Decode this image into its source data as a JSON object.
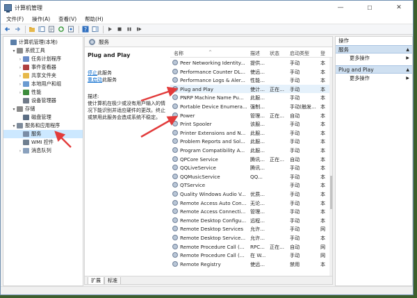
{
  "window": {
    "title": "计算机管理",
    "controls": {
      "minimize": "—",
      "maximize": "☐",
      "close": "✕"
    }
  },
  "menu": {
    "items": [
      "文件(F)",
      "操作(A)",
      "查看(V)",
      "帮助(H)"
    ]
  },
  "tree": {
    "items": [
      {
        "label": "计算机管理(本地)",
        "depth": 0,
        "twisty": "",
        "icon": "computer-icon",
        "color": "#5b7fa8"
      },
      {
        "label": "系统工具",
        "depth": 1,
        "twisty": "▾",
        "icon": "tools-icon",
        "color": "#8a8a8a"
      },
      {
        "label": "任务计划程序",
        "depth": 2,
        "twisty": "›",
        "icon": "clock-icon",
        "color": "#6a8cc8"
      },
      {
        "label": "事件查看器",
        "depth": 2,
        "twisty": "›",
        "icon": "event-log-icon",
        "color": "#b04040"
      },
      {
        "label": "共享文件夹",
        "depth": 2,
        "twisty": "›",
        "icon": "folder-icon",
        "color": "#e6b84a"
      },
      {
        "label": "本地用户和组",
        "depth": 2,
        "twisty": "›",
        "icon": "users-icon",
        "color": "#6b9bd1"
      },
      {
        "label": "性能",
        "depth": 2,
        "twisty": "›",
        "icon": "performance-icon",
        "color": "#3c8c3c"
      },
      {
        "label": "设备管理器",
        "depth": 2,
        "twisty": "",
        "icon": "device-manager-icon",
        "color": "#707a88"
      },
      {
        "label": "存储",
        "depth": 1,
        "twisty": "▾",
        "icon": "storage-icon",
        "color": "#8a8a8a"
      },
      {
        "label": "磁盘管理",
        "depth": 2,
        "twisty": "",
        "icon": "disk-icon",
        "color": "#5c6e84"
      },
      {
        "label": "服务和应用程序",
        "depth": 1,
        "twisty": "▾",
        "icon": "services-apps-icon",
        "color": "#7d8a9a"
      },
      {
        "label": "服务",
        "depth": 2,
        "twisty": "",
        "icon": "gear-icon",
        "color": "#7a8da6",
        "selected": true
      },
      {
        "label": "WMI 控件",
        "depth": 2,
        "twisty": "",
        "icon": "wmi-icon",
        "color": "#6f7f90"
      },
      {
        "label": "消息队列",
        "depth": 2,
        "twisty": "›",
        "icon": "message-queue-icon",
        "color": "#8aa1bd"
      }
    ]
  },
  "center": {
    "header": "服务",
    "selected_service": {
      "name": "Plug and Play",
      "stop_link": "停止",
      "stop_suffix": "此服务",
      "restart_link": "重启动",
      "restart_suffix": "此服务",
      "desc_label": "描述:",
      "desc_lines": [
        "使计算机在极少或没有用户输入的情",
        "况下能识别并适应硬件的更改。终止",
        "或禁用此服务会造成系统不稳定。"
      ]
    },
    "columns": {
      "name": "名称",
      "desc": "描述",
      "status": "状态",
      "startup": "启动类型",
      "logon": "登"
    },
    "rows": [
      {
        "name": "Peer Networking Identity...",
        "desc": "提供...",
        "status": "",
        "startup": "手动",
        "logon": "本"
      },
      {
        "name": "Performance Counter DL...",
        "desc": "使远...",
        "status": "",
        "startup": "手动",
        "logon": "本"
      },
      {
        "name": "Performance Logs & Aler...",
        "desc": "性能...",
        "status": "",
        "startup": "手动",
        "logon": "本"
      },
      {
        "name": "Plug and Play",
        "desc": "使计...",
        "status": "正在...",
        "startup": "手动",
        "logon": "本",
        "highlight": true
      },
      {
        "name": "PNRP Machine Name Pu...",
        "desc": "此服...",
        "status": "",
        "startup": "手动",
        "logon": "本"
      },
      {
        "name": "Portable Device Enumera...",
        "desc": "强制...",
        "status": "",
        "startup": "手动(触发...",
        "logon": "本"
      },
      {
        "name": "Power",
        "desc": "管理...",
        "status": "正在...",
        "startup": "自动",
        "logon": "本"
      },
      {
        "name": "Print Spooler",
        "desc": "该服...",
        "status": "",
        "startup": "手动",
        "logon": "本"
      },
      {
        "name": "Printer Extensions and N...",
        "desc": "此服...",
        "status": "",
        "startup": "手动",
        "logon": "本"
      },
      {
        "name": "Problem Reports and Sol...",
        "desc": "此服...",
        "status": "",
        "startup": "手动",
        "logon": "本"
      },
      {
        "name": "Program Compatibility A...",
        "desc": "此服...",
        "status": "",
        "startup": "手动",
        "logon": "本"
      },
      {
        "name": "QPCore Service",
        "desc": "腾讯...",
        "status": "正在...",
        "startup": "自动",
        "logon": "本"
      },
      {
        "name": "QQLiveService",
        "desc": "腾讯...",
        "status": "",
        "startup": "手动",
        "logon": "本"
      },
      {
        "name": "QQMusicService",
        "desc": "QQ...",
        "status": "",
        "startup": "手动",
        "logon": "本"
      },
      {
        "name": "QTService",
        "desc": "",
        "status": "",
        "startup": "手动",
        "logon": "本"
      },
      {
        "name": "Quality Windows Audio V...",
        "desc": "优质...",
        "status": "",
        "startup": "手动",
        "logon": "本"
      },
      {
        "name": "Remote Access Auto Con...",
        "desc": "无论...",
        "status": "",
        "startup": "手动",
        "logon": "本"
      },
      {
        "name": "Remote Access Connecti...",
        "desc": "管理...",
        "status": "",
        "startup": "手动",
        "logon": "本"
      },
      {
        "name": "Remote Desktop Configu...",
        "desc": "远程...",
        "status": "",
        "startup": "手动",
        "logon": "本"
      },
      {
        "name": "Remote Desktop Services",
        "desc": "允许...",
        "status": "",
        "startup": "手动",
        "logon": "网"
      },
      {
        "name": "Remote Desktop Service...",
        "desc": "允许...",
        "status": "",
        "startup": "手动",
        "logon": "本"
      },
      {
        "name": "Remote Procedure Call (...",
        "desc": "RPC...",
        "status": "正在...",
        "startup": "自动",
        "logon": "网"
      },
      {
        "name": "Remote Procedure Call (...",
        "desc": "在 W...",
        "status": "",
        "startup": "手动",
        "logon": "网"
      },
      {
        "name": "Remote Registry",
        "desc": "使远...",
        "status": "",
        "startup": "禁用",
        "logon": "本"
      }
    ],
    "tabs": [
      "扩展",
      "标准"
    ]
  },
  "actions": {
    "header": "操作",
    "sections": [
      {
        "title": "服务",
        "item": "更多操作"
      },
      {
        "title": "Plug and Play",
        "item": "更多操作"
      }
    ]
  },
  "colors": {
    "annotation_arrow": "#e23b3b",
    "selection": "#cce8ff",
    "action_section": "#cfe0f1"
  }
}
